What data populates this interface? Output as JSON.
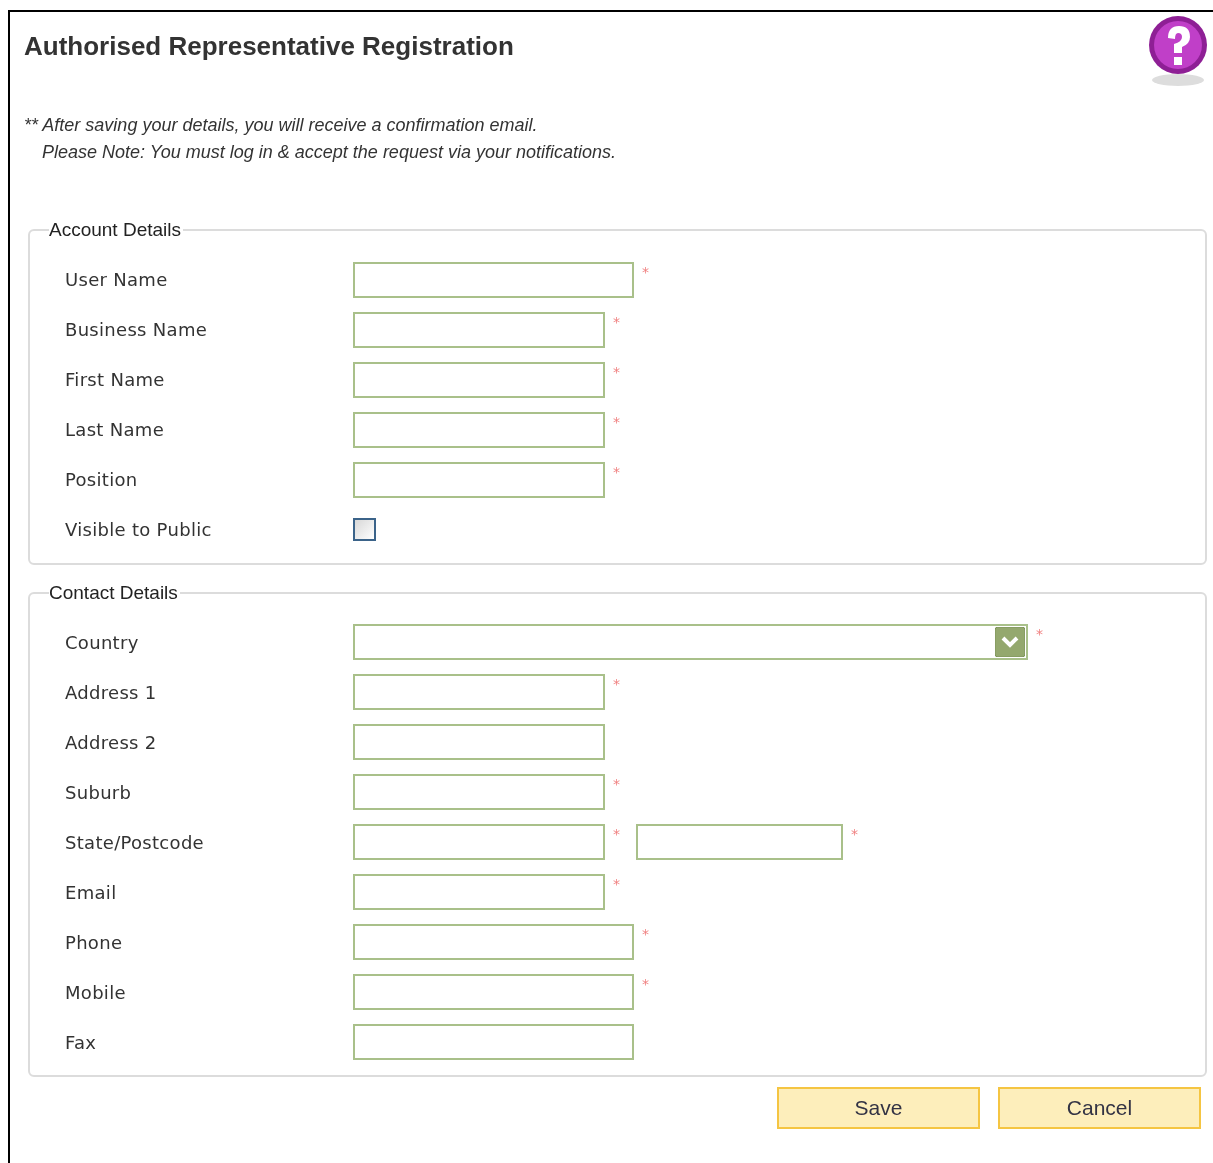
{
  "title": "Authorised Representative Registration",
  "notes": [
    "** After saving your details, you will receive a confirmation email.",
    "Please Note: You must log in & accept the request via your notifications."
  ],
  "sections": [
    {
      "legend": "Account Details",
      "fields": [
        {
          "label": "User Name",
          "kind": "wide",
          "marker": "*"
        },
        {
          "label": "Business Name",
          "kind": "text",
          "marker": "*"
        },
        {
          "label": "First Name",
          "kind": "text",
          "marker": "*"
        },
        {
          "label": "Last Name",
          "kind": "text",
          "marker": "*"
        },
        {
          "label": "Position",
          "kind": "text",
          "marker": "*"
        },
        {
          "label": "Visible to Public",
          "kind": "checkbox",
          "checked": false
        }
      ]
    },
    {
      "legend": "Contact Details",
      "fields": [
        {
          "label": "Country",
          "kind": "select",
          "marker": "*"
        },
        {
          "label": "Address 1",
          "kind": "text",
          "marker": "*"
        },
        {
          "label": "Address 2",
          "kind": "text"
        },
        {
          "label": "Suburb",
          "kind": "text",
          "marker": "*"
        },
        {
          "label": "State/Postcode",
          "kind": "pair",
          "marker": "*",
          "second_marker": "*"
        },
        {
          "label": "Email",
          "kind": "text",
          "marker": "*"
        },
        {
          "label": "Phone",
          "kind": "wide",
          "marker": "*"
        },
        {
          "label": "Mobile",
          "kind": "wide",
          "marker": "*"
        },
        {
          "label": "Fax",
          "kind": "wide"
        }
      ]
    }
  ],
  "buttons": [
    "Save",
    "Cancel"
  ]
}
